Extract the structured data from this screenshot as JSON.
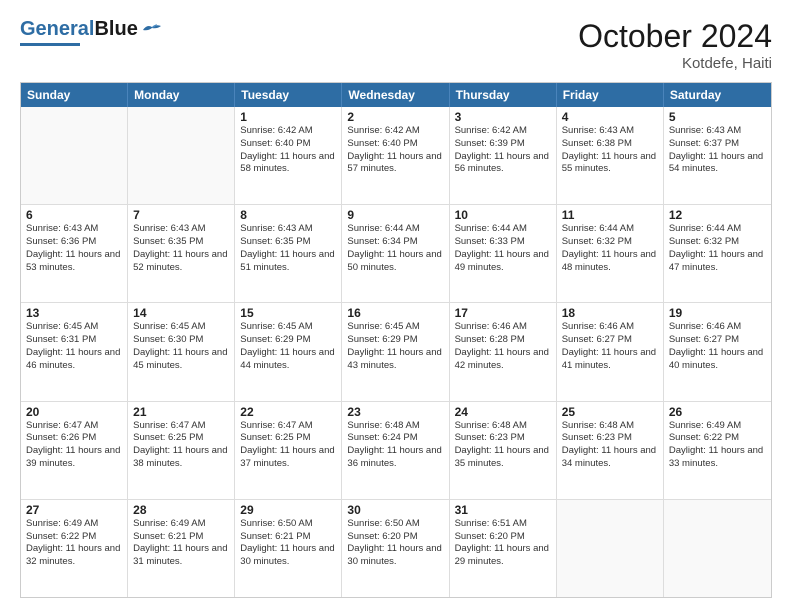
{
  "logo": {
    "part1": "General",
    "part2": "Blue"
  },
  "header": {
    "month": "October 2024",
    "location": "Kotdefe, Haiti"
  },
  "weekdays": [
    "Sunday",
    "Monday",
    "Tuesday",
    "Wednesday",
    "Thursday",
    "Friday",
    "Saturday"
  ],
  "weeks": [
    [
      {
        "day": "",
        "info": ""
      },
      {
        "day": "",
        "info": ""
      },
      {
        "day": "1",
        "info": "Sunrise: 6:42 AM\nSunset: 6:40 PM\nDaylight: 11 hours and 58 minutes."
      },
      {
        "day": "2",
        "info": "Sunrise: 6:42 AM\nSunset: 6:40 PM\nDaylight: 11 hours and 57 minutes."
      },
      {
        "day": "3",
        "info": "Sunrise: 6:42 AM\nSunset: 6:39 PM\nDaylight: 11 hours and 56 minutes."
      },
      {
        "day": "4",
        "info": "Sunrise: 6:43 AM\nSunset: 6:38 PM\nDaylight: 11 hours and 55 minutes."
      },
      {
        "day": "5",
        "info": "Sunrise: 6:43 AM\nSunset: 6:37 PM\nDaylight: 11 hours and 54 minutes."
      }
    ],
    [
      {
        "day": "6",
        "info": "Sunrise: 6:43 AM\nSunset: 6:36 PM\nDaylight: 11 hours and 53 minutes."
      },
      {
        "day": "7",
        "info": "Sunrise: 6:43 AM\nSunset: 6:35 PM\nDaylight: 11 hours and 52 minutes."
      },
      {
        "day": "8",
        "info": "Sunrise: 6:43 AM\nSunset: 6:35 PM\nDaylight: 11 hours and 51 minutes."
      },
      {
        "day": "9",
        "info": "Sunrise: 6:44 AM\nSunset: 6:34 PM\nDaylight: 11 hours and 50 minutes."
      },
      {
        "day": "10",
        "info": "Sunrise: 6:44 AM\nSunset: 6:33 PM\nDaylight: 11 hours and 49 minutes."
      },
      {
        "day": "11",
        "info": "Sunrise: 6:44 AM\nSunset: 6:32 PM\nDaylight: 11 hours and 48 minutes."
      },
      {
        "day": "12",
        "info": "Sunrise: 6:44 AM\nSunset: 6:32 PM\nDaylight: 11 hours and 47 minutes."
      }
    ],
    [
      {
        "day": "13",
        "info": "Sunrise: 6:45 AM\nSunset: 6:31 PM\nDaylight: 11 hours and 46 minutes."
      },
      {
        "day": "14",
        "info": "Sunrise: 6:45 AM\nSunset: 6:30 PM\nDaylight: 11 hours and 45 minutes."
      },
      {
        "day": "15",
        "info": "Sunrise: 6:45 AM\nSunset: 6:29 PM\nDaylight: 11 hours and 44 minutes."
      },
      {
        "day": "16",
        "info": "Sunrise: 6:45 AM\nSunset: 6:29 PM\nDaylight: 11 hours and 43 minutes."
      },
      {
        "day": "17",
        "info": "Sunrise: 6:46 AM\nSunset: 6:28 PM\nDaylight: 11 hours and 42 minutes."
      },
      {
        "day": "18",
        "info": "Sunrise: 6:46 AM\nSunset: 6:27 PM\nDaylight: 11 hours and 41 minutes."
      },
      {
        "day": "19",
        "info": "Sunrise: 6:46 AM\nSunset: 6:27 PM\nDaylight: 11 hours and 40 minutes."
      }
    ],
    [
      {
        "day": "20",
        "info": "Sunrise: 6:47 AM\nSunset: 6:26 PM\nDaylight: 11 hours and 39 minutes."
      },
      {
        "day": "21",
        "info": "Sunrise: 6:47 AM\nSunset: 6:25 PM\nDaylight: 11 hours and 38 minutes."
      },
      {
        "day": "22",
        "info": "Sunrise: 6:47 AM\nSunset: 6:25 PM\nDaylight: 11 hours and 37 minutes."
      },
      {
        "day": "23",
        "info": "Sunrise: 6:48 AM\nSunset: 6:24 PM\nDaylight: 11 hours and 36 minutes."
      },
      {
        "day": "24",
        "info": "Sunrise: 6:48 AM\nSunset: 6:23 PM\nDaylight: 11 hours and 35 minutes."
      },
      {
        "day": "25",
        "info": "Sunrise: 6:48 AM\nSunset: 6:23 PM\nDaylight: 11 hours and 34 minutes."
      },
      {
        "day": "26",
        "info": "Sunrise: 6:49 AM\nSunset: 6:22 PM\nDaylight: 11 hours and 33 minutes."
      }
    ],
    [
      {
        "day": "27",
        "info": "Sunrise: 6:49 AM\nSunset: 6:22 PM\nDaylight: 11 hours and 32 minutes."
      },
      {
        "day": "28",
        "info": "Sunrise: 6:49 AM\nSunset: 6:21 PM\nDaylight: 11 hours and 31 minutes."
      },
      {
        "day": "29",
        "info": "Sunrise: 6:50 AM\nSunset: 6:21 PM\nDaylight: 11 hours and 30 minutes."
      },
      {
        "day": "30",
        "info": "Sunrise: 6:50 AM\nSunset: 6:20 PM\nDaylight: 11 hours and 30 minutes."
      },
      {
        "day": "31",
        "info": "Sunrise: 6:51 AM\nSunset: 6:20 PM\nDaylight: 11 hours and 29 minutes."
      },
      {
        "day": "",
        "info": ""
      },
      {
        "day": "",
        "info": ""
      }
    ]
  ]
}
